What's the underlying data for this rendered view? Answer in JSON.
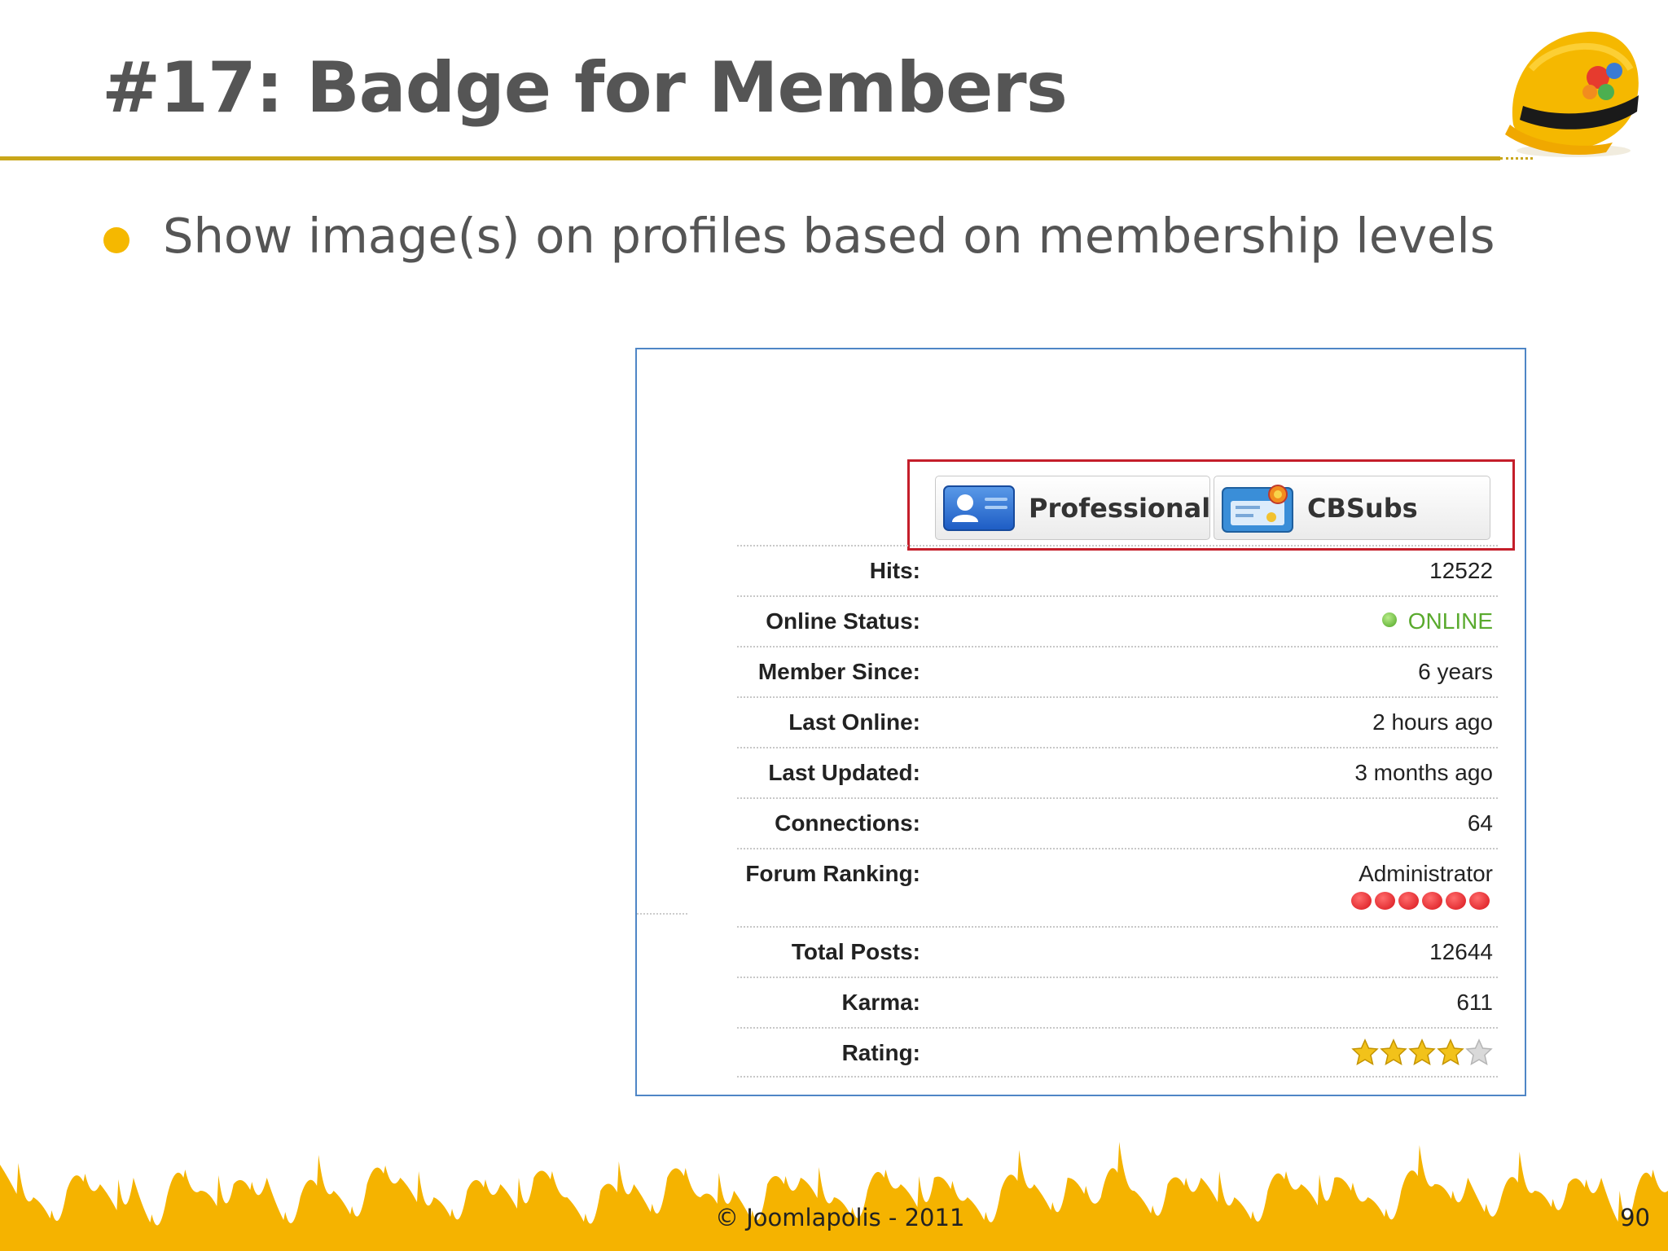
{
  "slide": {
    "title": "#17: Badge for Members",
    "bullet": "Show image(s) on profiles based on membership levels",
    "footer": "© Joomlapolis - 2011",
    "page_number": "90"
  },
  "badges": [
    {
      "label": "Professional",
      "icon": "user-card-icon"
    },
    {
      "label": "CBSubs",
      "icon": "membership-card-icon"
    }
  ],
  "profile": {
    "rows": [
      {
        "label": "Hits:",
        "value": "12522"
      },
      {
        "label": "Online Status:",
        "value": "ONLINE"
      },
      {
        "label": "Member Since:",
        "value": "6 years"
      },
      {
        "label": "Last Online:",
        "value": "2 hours ago"
      },
      {
        "label": "Last Updated:",
        "value": "3 months ago"
      },
      {
        "label": "Connections:",
        "value": "64"
      },
      {
        "label": "Forum Ranking:",
        "value": "Administrator",
        "rank_dots": 6
      },
      {
        "label": "Total Posts:",
        "value": "12644"
      },
      {
        "label": "Karma:",
        "value": "611"
      },
      {
        "label": "Rating:",
        "rating": 4,
        "rating_max": 5
      }
    ]
  },
  "colors": {
    "accent": "#f5b800",
    "title_rule": "#c9a61a",
    "highlight_box": "#c41e2a",
    "online_green": "#5aaa2e",
    "frame_border": "#4f86c6"
  }
}
